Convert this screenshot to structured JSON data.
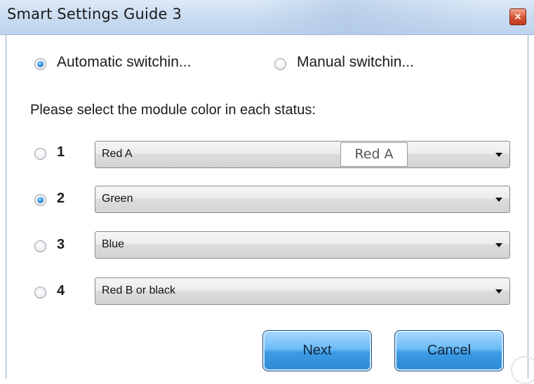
{
  "window": {
    "title": "Smart Settings Guide 3",
    "close_glyph": "×"
  },
  "mode": {
    "automatic_label": "Automatic switchin...",
    "automatic_selected": true,
    "manual_label": "Manual switchin...",
    "manual_selected": false
  },
  "instruction": "Please select the module color in each status:",
  "statuses": [
    {
      "number": "1",
      "selected": false,
      "color": "Red A"
    },
    {
      "number": "2",
      "selected": true,
      "color": "Green"
    },
    {
      "number": "3",
      "selected": false,
      "color": "Blue"
    },
    {
      "number": "4",
      "selected": false,
      "color": "Red B or black"
    }
  ],
  "tooltip": "Red A",
  "buttons": {
    "next": "Next",
    "cancel": "Cancel"
  },
  "colors": {
    "titlebar": "#c9dcf1",
    "close_button": "#d8573a",
    "push_button": "#5fb0f0"
  }
}
